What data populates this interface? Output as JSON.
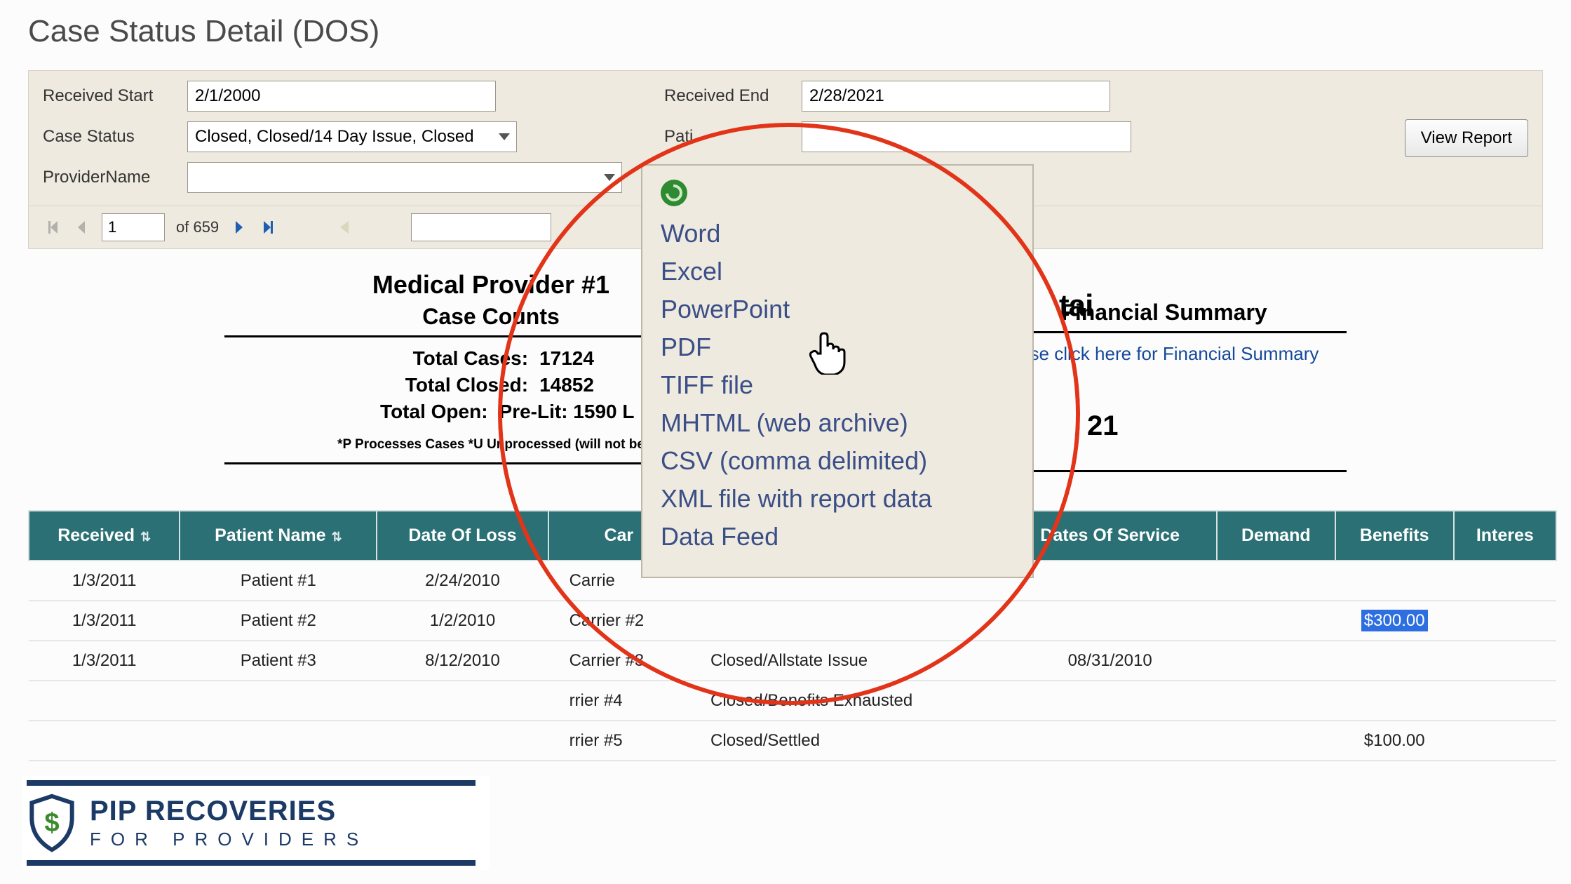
{
  "title": "Case Status Detail (DOS)",
  "filters": {
    "received_start_label": "Received Start",
    "received_start_value": "2/1/2000",
    "received_end_label": "Received End",
    "received_end_value": "2/28/2021",
    "case_status_label": "Case Status",
    "case_status_value": "Closed, Closed/14 Day Issue, Closed",
    "patient_label": "Pati",
    "patient_value": "",
    "provider_label": "ProviderName",
    "provider_value": "",
    "view_report": "View Report"
  },
  "pager": {
    "page": "1",
    "of_label": "of 659"
  },
  "summary": {
    "provider_heading": "Medical Provider #1",
    "case_counts_heading": "Case Counts",
    "total_cases_label": "Total Cases:",
    "total_cases_value": "17124",
    "total_closed_label": "Total Closed:",
    "total_closed_value": "14852",
    "total_open_label": "Total Open:",
    "total_open_value": "Pre-Lit: 1590 L",
    "footnote": "*P Processes Cases   *U Unprocessed (will not be",
    "center_tail": "tai",
    "right_21": "21",
    "financial_heading": "Financial Summary",
    "financial_link": "ease click here for Financial Summary"
  },
  "export_menu": {
    "items": [
      "Word",
      "Excel",
      "PowerPoint",
      "PDF",
      "TIFF file",
      "MHTML (web archive)",
      "CSV (comma delimited)",
      "XML file with report data",
      "Data Feed"
    ]
  },
  "table": {
    "columns": [
      "Received",
      "Patient Name",
      "Date Of Loss",
      "Car",
      "",
      "Dates Of Service",
      "Demand",
      "Benefits",
      "Interes"
    ],
    "rows": [
      {
        "received": "1/3/2011",
        "patient": "Patient #1",
        "dol": "2/24/2010",
        "carrier": "Carrie",
        "status": "",
        "dos": "",
        "demand": "",
        "benefits": "",
        "interest": ""
      },
      {
        "received": "1/3/2011",
        "patient": "Patient #2",
        "dol": "1/2/2010",
        "carrier": "Carrier #2",
        "status": "",
        "dos": "",
        "demand": "",
        "benefits": "$300.00",
        "benefits_hl": true,
        "interest": ""
      },
      {
        "received": "1/3/2011",
        "patient": "Patient #3",
        "dol": "8/12/2010",
        "carrier": "Carrier #3",
        "status": "Closed/Allstate Issue",
        "dos": "08/31/2010",
        "demand": "",
        "benefits": "",
        "interest": ""
      },
      {
        "received": "",
        "patient": "",
        "dol": "",
        "carrier": "rrier #4",
        "status": "Closed/Benefits Exhausted",
        "dos": "",
        "demand": "",
        "benefits": "",
        "interest": ""
      },
      {
        "received": "",
        "patient": "",
        "dol": "",
        "carrier": "rrier #5",
        "status": "Closed/Settled",
        "dos": "",
        "demand": "",
        "benefits": "$100.00",
        "interest": ""
      }
    ]
  },
  "logo": {
    "line1": "PIP RECOVERIES",
    "line2": "FOR PROVIDERS"
  }
}
